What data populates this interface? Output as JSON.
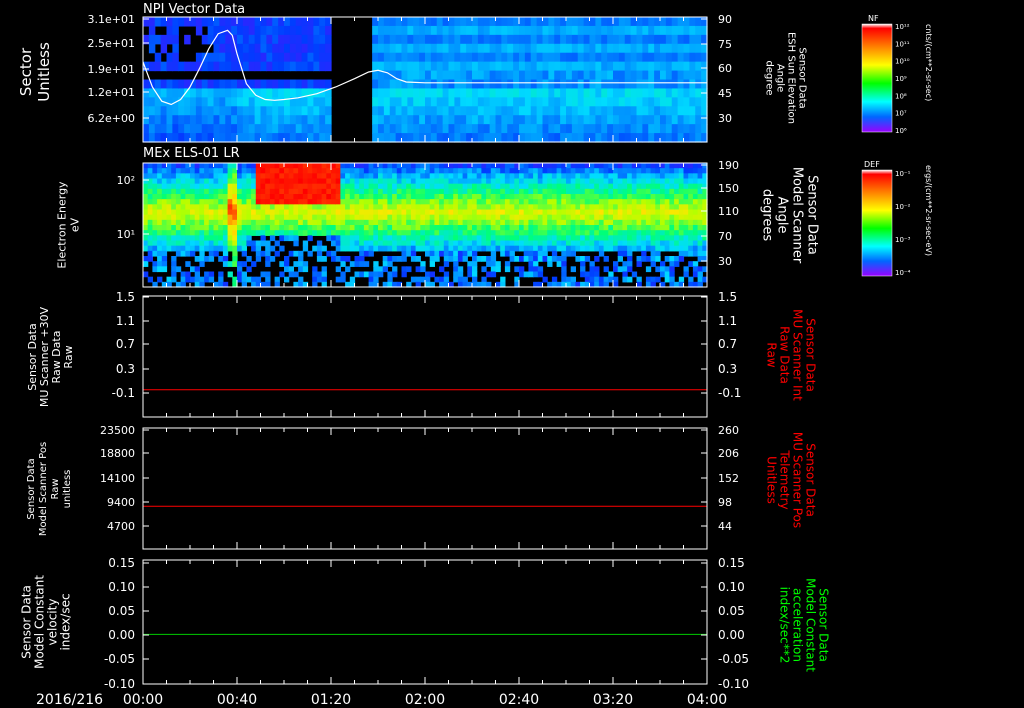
{
  "date_label": "2016/216",
  "time_axis": {
    "labels": [
      "00:00",
      "00:40",
      "01:20",
      "02:00",
      "02:40",
      "03:20",
      "04:00"
    ],
    "minutes": [
      0,
      40,
      80,
      120,
      160,
      200,
      240
    ],
    "range_minutes": [
      0,
      240
    ]
  },
  "colors": {
    "background": "#000000",
    "axis": "#ffffff",
    "red_label": "#ff0000",
    "green_label": "#00ff00",
    "trace_white": "#ffffff",
    "trace_red": "#ff0000",
    "trace_green": "#00cc00"
  },
  "chart_data": [
    {
      "type": "heatmap",
      "title": "NPI Vector Data",
      "ylabel": [
        "Sector",
        "Unitless"
      ],
      "yticks": [
        "3.1e+01",
        "2.5e+01",
        "1.9e+01",
        "1.2e+01",
        "6.2e+00"
      ],
      "y2label": [
        "Sensor Data",
        "ESH Sun Elevation",
        "Angle",
        "degree"
      ],
      "y2ticks": [
        "90",
        "75",
        "60",
        "45",
        "30"
      ],
      "y2lim": [
        15,
        90
      ],
      "data_gap_minutes": [
        80,
        97
      ],
      "overlay_line": {
        "name": "ESH Sun Elevation Angle",
        "x_minutes": [
          0,
          4,
          8,
          12,
          16,
          20,
          24,
          28,
          32,
          36,
          38,
          40,
          44,
          48,
          52,
          56,
          60,
          66,
          74,
          82,
          90,
          96,
          100,
          104,
          108,
          112,
          120,
          240
        ],
        "y_degrees": [
          63,
          48,
          39.5,
          37.5,
          40.5,
          48,
          59,
          71,
          80,
          82,
          79,
          68,
          50,
          43,
          40.5,
          40,
          40.5,
          41.5,
          44,
          48,
          53,
          57,
          58,
          56.5,
          53,
          51,
          50.5,
          50.5
        ]
      },
      "colorbar": {
        "label": "NF",
        "units": "cnts/(cm**2-sr-sec)",
        "ticks": [
          "10¹²",
          "10¹¹",
          "10¹⁰",
          "10⁹",
          "10⁸",
          "10⁷",
          "10⁶"
        ]
      }
    },
    {
      "type": "heatmap",
      "title": "MEx ELS-01 LR",
      "ylabel": [
        "Electron Energy",
        "eV"
      ],
      "yticks": [
        "10²",
        "10¹"
      ],
      "y2label": [
        "Sensor Data",
        "Model Scanner",
        "Angle",
        "degrees"
      ],
      "y2ticks": [
        "190",
        "150",
        "110",
        "70",
        "30"
      ],
      "y2lim": [
        0,
        190
      ],
      "colorbar": {
        "label": "DEF",
        "units": "ergs/(cm**2-sr-sec-eV)",
        "ticks": [
          "10⁻¹",
          "10⁻²",
          "10⁻³",
          "10⁻⁴"
        ]
      }
    },
    {
      "type": "line",
      "ylabel": [
        "Sensor Data",
        "MU Scanner +30V",
        "Raw Data",
        "Raw"
      ],
      "yticks": [
        "1.5",
        "1.1",
        "0.7",
        "0.3",
        "-0.1"
      ],
      "ylim": [
        -0.5,
        1.5
      ],
      "y2label": [
        "Sensor Data",
        "MU Scanner Int",
        "Raw Data",
        "Raw"
      ],
      "y2ticks": [
        "1.5",
        "1.1",
        "0.7",
        "0.3",
        "-0.1"
      ],
      "series": [
        {
          "x_minutes": [
            0,
            240
          ],
          "values": [
            -0.05,
            -0.05
          ]
        }
      ]
    },
    {
      "type": "line",
      "ylabel": [
        "Sensor Data",
        "Model Scanner Pos",
        "Raw",
        "unitless"
      ],
      "yticks": [
        "23500",
        "18800",
        "14100",
        "9400",
        "4700"
      ],
      "ylim": [
        0,
        23500
      ],
      "y2label": [
        "Sensor Data",
        "MU Scanner Pos",
        "Telemetry",
        "Unitless"
      ],
      "y2ticks": [
        "260",
        "206",
        "152",
        "98",
        "44"
      ],
      "series": [
        {
          "x_minutes": [
            0,
            240
          ],
          "values": [
            8300,
            8300
          ]
        }
      ]
    },
    {
      "type": "line",
      "ylabel": [
        "Sensor Data",
        "Model Constant",
        "velocity",
        "index/sec"
      ],
      "yticks": [
        "0.15",
        "0.10",
        "0.05",
        "0.00",
        "-0.05",
        "-0.10"
      ],
      "ylim": [
        -0.1,
        0.15
      ],
      "y2label": [
        "Sensor Data",
        "Model Constant",
        "acceleration",
        "index/sec**2"
      ],
      "y2ticks": [
        "0.15",
        "0.10",
        "0.05",
        "0.00",
        "-0.05",
        "-0.10"
      ],
      "series": [
        {
          "x_minutes": [
            0,
            240
          ],
          "values": [
            0.0,
            0.0
          ]
        }
      ]
    }
  ]
}
